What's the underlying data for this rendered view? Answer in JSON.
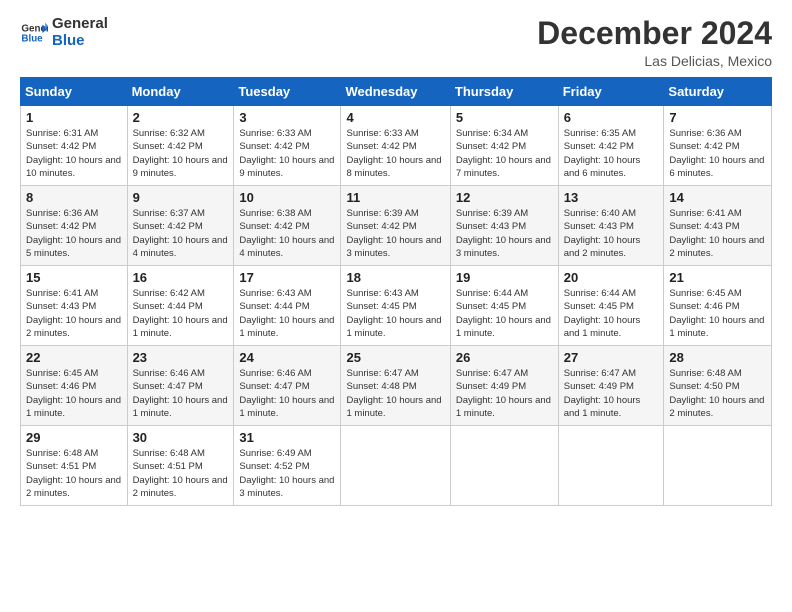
{
  "logo": {
    "line1": "General",
    "line2": "Blue"
  },
  "title": "December 2024",
  "location": "Las Delicias, Mexico",
  "weekdays": [
    "Sunday",
    "Monday",
    "Tuesday",
    "Wednesday",
    "Thursday",
    "Friday",
    "Saturday"
  ],
  "weeks": [
    [
      {
        "day": "1",
        "sunrise": "6:31 AM",
        "sunset": "4:42 PM",
        "daylight": "10 hours and 10 minutes."
      },
      {
        "day": "2",
        "sunrise": "6:32 AM",
        "sunset": "4:42 PM",
        "daylight": "10 hours and 9 minutes."
      },
      {
        "day": "3",
        "sunrise": "6:33 AM",
        "sunset": "4:42 PM",
        "daylight": "10 hours and 9 minutes."
      },
      {
        "day": "4",
        "sunrise": "6:33 AM",
        "sunset": "4:42 PM",
        "daylight": "10 hours and 8 minutes."
      },
      {
        "day": "5",
        "sunrise": "6:34 AM",
        "sunset": "4:42 PM",
        "daylight": "10 hours and 7 minutes."
      },
      {
        "day": "6",
        "sunrise": "6:35 AM",
        "sunset": "4:42 PM",
        "daylight": "10 hours and 6 minutes."
      },
      {
        "day": "7",
        "sunrise": "6:36 AM",
        "sunset": "4:42 PM",
        "daylight": "10 hours and 6 minutes."
      }
    ],
    [
      {
        "day": "8",
        "sunrise": "6:36 AM",
        "sunset": "4:42 PM",
        "daylight": "10 hours and 5 minutes."
      },
      {
        "day": "9",
        "sunrise": "6:37 AM",
        "sunset": "4:42 PM",
        "daylight": "10 hours and 4 minutes."
      },
      {
        "day": "10",
        "sunrise": "6:38 AM",
        "sunset": "4:42 PM",
        "daylight": "10 hours and 4 minutes."
      },
      {
        "day": "11",
        "sunrise": "6:39 AM",
        "sunset": "4:42 PM",
        "daylight": "10 hours and 3 minutes."
      },
      {
        "day": "12",
        "sunrise": "6:39 AM",
        "sunset": "4:43 PM",
        "daylight": "10 hours and 3 minutes."
      },
      {
        "day": "13",
        "sunrise": "6:40 AM",
        "sunset": "4:43 PM",
        "daylight": "10 hours and 2 minutes."
      },
      {
        "day": "14",
        "sunrise": "6:41 AM",
        "sunset": "4:43 PM",
        "daylight": "10 hours and 2 minutes."
      }
    ],
    [
      {
        "day": "15",
        "sunrise": "6:41 AM",
        "sunset": "4:43 PM",
        "daylight": "10 hours and 2 minutes."
      },
      {
        "day": "16",
        "sunrise": "6:42 AM",
        "sunset": "4:44 PM",
        "daylight": "10 hours and 1 minute."
      },
      {
        "day": "17",
        "sunrise": "6:43 AM",
        "sunset": "4:44 PM",
        "daylight": "10 hours and 1 minute."
      },
      {
        "day": "18",
        "sunrise": "6:43 AM",
        "sunset": "4:45 PM",
        "daylight": "10 hours and 1 minute."
      },
      {
        "day": "19",
        "sunrise": "6:44 AM",
        "sunset": "4:45 PM",
        "daylight": "10 hours and 1 minute."
      },
      {
        "day": "20",
        "sunrise": "6:44 AM",
        "sunset": "4:45 PM",
        "daylight": "10 hours and 1 minute."
      },
      {
        "day": "21",
        "sunrise": "6:45 AM",
        "sunset": "4:46 PM",
        "daylight": "10 hours and 1 minute."
      }
    ],
    [
      {
        "day": "22",
        "sunrise": "6:45 AM",
        "sunset": "4:46 PM",
        "daylight": "10 hours and 1 minute."
      },
      {
        "day": "23",
        "sunrise": "6:46 AM",
        "sunset": "4:47 PM",
        "daylight": "10 hours and 1 minute."
      },
      {
        "day": "24",
        "sunrise": "6:46 AM",
        "sunset": "4:47 PM",
        "daylight": "10 hours and 1 minute."
      },
      {
        "day": "25",
        "sunrise": "6:47 AM",
        "sunset": "4:48 PM",
        "daylight": "10 hours and 1 minute."
      },
      {
        "day": "26",
        "sunrise": "6:47 AM",
        "sunset": "4:49 PM",
        "daylight": "10 hours and 1 minute."
      },
      {
        "day": "27",
        "sunrise": "6:47 AM",
        "sunset": "4:49 PM",
        "daylight": "10 hours and 1 minute."
      },
      {
        "day": "28",
        "sunrise": "6:48 AM",
        "sunset": "4:50 PM",
        "daylight": "10 hours and 2 minutes."
      }
    ],
    [
      {
        "day": "29",
        "sunrise": "6:48 AM",
        "sunset": "4:51 PM",
        "daylight": "10 hours and 2 minutes."
      },
      {
        "day": "30",
        "sunrise": "6:48 AM",
        "sunset": "4:51 PM",
        "daylight": "10 hours and 2 minutes."
      },
      {
        "day": "31",
        "sunrise": "6:49 AM",
        "sunset": "4:52 PM",
        "daylight": "10 hours and 3 minutes."
      },
      null,
      null,
      null,
      null
    ]
  ]
}
